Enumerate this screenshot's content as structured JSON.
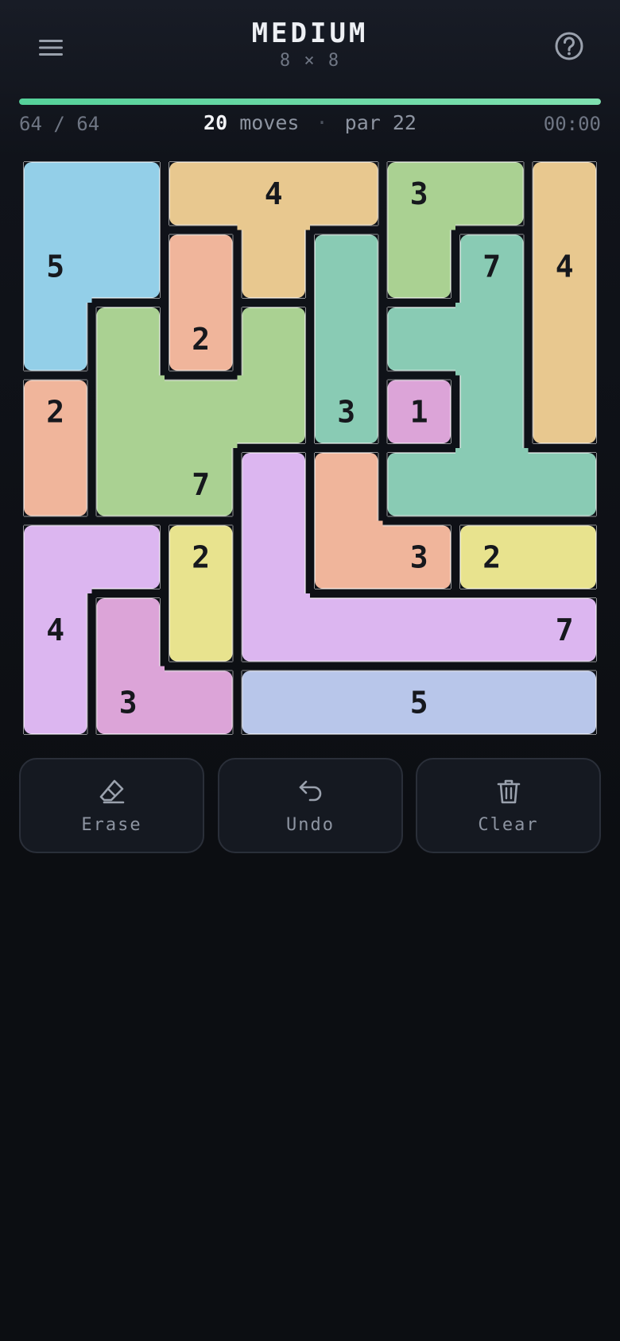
{
  "header": {
    "title": "MEDIUM",
    "subtitle": "8 × 8",
    "menu_icon": "hamburger-menu-icon",
    "help_icon": "question-circle-icon"
  },
  "progress": {
    "filled": 64,
    "total": 64,
    "fraction": 1.0,
    "text": "64 / 64",
    "color": "#55d19a"
  },
  "stats": {
    "moves": "20",
    "moves_label": "moves",
    "separator": "·",
    "par": "par 22",
    "timer": "00:00"
  },
  "board": {
    "rows": 8,
    "cols": 8,
    "regions": [
      {
        "id": "r1",
        "number": "5",
        "label_cell": [
          1,
          0
        ],
        "color": "#93cfe8",
        "cells": [
          [
            0,
            0
          ],
          [
            0,
            1
          ],
          [
            1,
            0
          ],
          [
            1,
            1
          ],
          [
            2,
            0
          ]
        ]
      },
      {
        "id": "r2",
        "number": "4",
        "label_cell": [
          0,
          3
        ],
        "color": "#e8c88f",
        "cells": [
          [
            0,
            2
          ],
          [
            0,
            3
          ],
          [
            0,
            4
          ],
          [
            1,
            3
          ]
        ]
      },
      {
        "id": "r3",
        "number": "3",
        "label_cell": [
          0,
          5
        ],
        "color": "#aad192",
        "cells": [
          [
            0,
            5
          ],
          [
            0,
            6
          ],
          [
            1,
            5
          ]
        ]
      },
      {
        "id": "r4",
        "number": "4",
        "label_cell": [
          1,
          7
        ],
        "color": "#e8c88f",
        "cells": [
          [
            0,
            7
          ],
          [
            1,
            7
          ],
          [
            2,
            7
          ],
          [
            3,
            7
          ]
        ]
      },
      {
        "id": "r5",
        "number": "2",
        "label_cell": [
          2,
          2
        ],
        "color": "#f0b59b",
        "cells": [
          [
            1,
            2
          ],
          [
            2,
            2
          ]
        ]
      },
      {
        "id": "r6",
        "number": "3",
        "label_cell": [
          3,
          4
        ],
        "color": "#89cbb4",
        "cells": [
          [
            1,
            4
          ],
          [
            2,
            4
          ],
          [
            3,
            4
          ]
        ]
      },
      {
        "id": "r7",
        "number": "7",
        "label_cell": [
          1,
          6
        ],
        "color": "#89cbb4",
        "cells": [
          [
            1,
            6
          ],
          [
            2,
            5
          ],
          [
            2,
            6
          ],
          [
            3,
            6
          ],
          [
            4,
            5
          ],
          [
            4,
            6
          ],
          [
            4,
            7
          ]
        ]
      },
      {
        "id": "r8",
        "number": "7",
        "label_cell": [
          4,
          2
        ],
        "color": "#aad192",
        "cells": [
          [
            2,
            1
          ],
          [
            2,
            3
          ],
          [
            3,
            1
          ],
          [
            3,
            2
          ],
          [
            3,
            3
          ],
          [
            4,
            1
          ],
          [
            4,
            2
          ]
        ]
      },
      {
        "id": "r9",
        "number": "2",
        "label_cell": [
          3,
          0
        ],
        "color": "#f0b59b",
        "cells": [
          [
            3,
            0
          ],
          [
            4,
            0
          ]
        ]
      },
      {
        "id": "r10",
        "number": "1",
        "label_cell": [
          3,
          5
        ],
        "color": "#dca4d8",
        "cells": [
          [
            3,
            5
          ]
        ]
      },
      {
        "id": "r11",
        "number": "7",
        "label_cell": [
          6,
          7
        ],
        "color": "#dcb6f0",
        "cells": [
          [
            4,
            3
          ],
          [
            5,
            3
          ],
          [
            6,
            3
          ],
          [
            6,
            4
          ],
          [
            6,
            5
          ],
          [
            6,
            6
          ],
          [
            6,
            7
          ]
        ]
      },
      {
        "id": "r12",
        "number": "3",
        "label_cell": [
          5,
          5
        ],
        "color": "#f0b59b",
        "cells": [
          [
            4,
            4
          ],
          [
            5,
            4
          ],
          [
            5,
            5
          ]
        ]
      },
      {
        "id": "r13",
        "number": "4",
        "label_cell": [
          6,
          0
        ],
        "color": "#dcb6f0",
        "cells": [
          [
            5,
            0
          ],
          [
            5,
            1
          ],
          [
            6,
            0
          ],
          [
            7,
            0
          ]
        ]
      },
      {
        "id": "r14",
        "number": "2",
        "label_cell": [
          5,
          2
        ],
        "color": "#e8e38e",
        "cells": [
          [
            5,
            2
          ],
          [
            6,
            2
          ]
        ]
      },
      {
        "id": "r15",
        "number": "2",
        "label_cell": [
          5,
          6
        ],
        "color": "#e8e38e",
        "cells": [
          [
            5,
            6
          ],
          [
            5,
            7
          ]
        ]
      },
      {
        "id": "r16",
        "number": "3",
        "label_cell": [
          7,
          1
        ],
        "color": "#dca4d8",
        "cells": [
          [
            6,
            1
          ],
          [
            7,
            1
          ],
          [
            7,
            2
          ]
        ]
      },
      {
        "id": "r17",
        "number": "5",
        "label_cell": [
          7,
          5
        ],
        "color": "#b8c6ea",
        "cells": [
          [
            7,
            3
          ],
          [
            7,
            4
          ],
          [
            7,
            5
          ],
          [
            7,
            6
          ],
          [
            7,
            7
          ]
        ]
      }
    ]
  },
  "actions": [
    {
      "id": "erase",
      "label": "Erase",
      "icon": "eraser-icon"
    },
    {
      "id": "undo",
      "label": "Undo",
      "icon": "undo-icon"
    },
    {
      "id": "clear",
      "label": "Clear",
      "icon": "trash-icon"
    }
  ]
}
